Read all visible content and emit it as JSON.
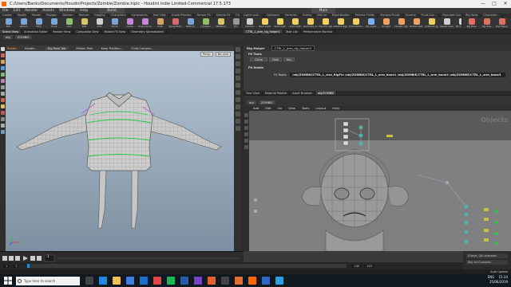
{
  "window": {
    "title": "C:/Users/Banks/Documents/HoudiniProjects/Zombie/Zombie.hiplc - Houdini Indie Limited-Commercial 17.5.173",
    "controls": [
      "—",
      "□",
      "✕"
    ]
  },
  "menubar": [
    "File",
    "Edit",
    "Render",
    "Assets",
    "Windows",
    "Help"
  ],
  "build_label": "Build",
  "main_label": "Main",
  "shelf_left": {
    "tabs": [
      "Create",
      "Modify",
      "Model",
      "Polygon",
      "Deform",
      "Texture",
      "Rigging",
      "Characters",
      "Constraints",
      "Hair Utils",
      "Guide Process",
      "Terrain FX",
      "Simple FX",
      "Cloud FX"
    ],
    "tools": [
      {
        "label": "Box",
        "color": "#7aa6d6"
      },
      {
        "label": "Sphere",
        "color": "#7aa6d6"
      },
      {
        "label": "Tube",
        "color": "#7aa6d6"
      },
      {
        "label": "Torus",
        "color": "#7aa6d6"
      },
      {
        "label": "Grid",
        "color": "#8fbf6a"
      },
      {
        "label": "Null",
        "color": "#d6c36a"
      },
      {
        "label": "Line",
        "color": "#d0d0d0"
      },
      {
        "label": "Circle",
        "color": "#7aa6d6"
      },
      {
        "label": "Curve",
        "color": "#c58ad6"
      },
      {
        "label": "Draw Curve",
        "color": "#c58ad6"
      },
      {
        "label": "Path",
        "color": "#d6a56a"
      },
      {
        "label": "Spray Paint",
        "color": "#d66a6a"
      },
      {
        "label": "Platonic",
        "color": "#7aa6d6"
      },
      {
        "label": "L-System",
        "color": "#8fbf6a"
      },
      {
        "label": "Metaball",
        "color": "#d6c36a"
      },
      {
        "label": "File",
        "color": "#9a9a9a"
      }
    ]
  },
  "shelf_right": {
    "tabs": [
      "Lights and...",
      "Collisions",
      "Particles",
      "Grains",
      "Vellum",
      "Rigid Bodies",
      "Particle Fluids",
      "Viscous Fluids",
      "Oceans",
      "Fluid Con...",
      "Populate Con...",
      "Container Tools",
      "Pyro FX",
      "Sparse Pyro FX",
      "FEM",
      "Wires",
      "Crowds",
      "Drive Simulation"
    ],
    "tools": [
      {
        "label": "Camera",
        "color": "#d0d0d0"
      },
      {
        "label": "Point Light",
        "color": "#f0d060"
      },
      {
        "label": "Spot Light",
        "color": "#f0d060"
      },
      {
        "label": "Area Light",
        "color": "#f0d060"
      },
      {
        "label": "Geometry Light",
        "color": "#f0d060"
      },
      {
        "label": "Volume Light",
        "color": "#f0d060"
      },
      {
        "label": "Distant Light",
        "color": "#f0d060"
      },
      {
        "label": "Environment Light",
        "color": "#f0d060"
      },
      {
        "label": "Sky Light",
        "color": "#7ab0f0"
      },
      {
        "label": "GI Light",
        "color": "#f0a060"
      },
      {
        "label": "Caustic Light",
        "color": "#f0a060"
      },
      {
        "label": "Portal Light",
        "color": "#f0a060"
      },
      {
        "label": "Ambient Light",
        "color": "#f0d060"
      },
      {
        "label": "Stereo Camera",
        "color": "#d0d0d0"
      },
      {
        "label": "VR Camera",
        "color": "#d0d0d0"
      },
      {
        "label": "Switcher",
        "color": "#d0d0d0"
      },
      {
        "label": "Gamepad Camera",
        "color": "#d0d0d0"
      }
    ]
  },
  "shelf_right2": {
    "tabs": [
      "Rig Tools",
      "Character..."
    ],
    "tools": [
      {
        "label": "Rig Pose",
        "color": "#e07060"
      },
      {
        "label": "Rig Tree",
        "color": "#e07060"
      },
      {
        "label": "Rig Helper",
        "color": "#e07060"
      },
      {
        "label": "Rig Edit",
        "color": "#e07060"
      }
    ]
  },
  "viewer_tabs": [
    "Scene View",
    "Animation Editor",
    "Render View",
    "Composite View",
    "Motion FX View",
    "Geometry Spreadsheet"
  ],
  "viewer_path": [
    "obj",
    "ZOMBIE"
  ],
  "viewport_toolbar": {
    "tool": "Rotate",
    "handle": "Handle...",
    "group_label": "Rig Pose Tab",
    "motion_path": "Motion Path",
    "keep_position": "Keep Position...",
    "child_compensation": "Child Compen..."
  },
  "viewport_labels": {
    "view": "Persp",
    "cam": "No cam"
  },
  "rig_tabs": [
    "CTRL_L_arm_rig_helper1",
    "Take List",
    "Performance Monitor"
  ],
  "rig_header": {
    "title": "Rig Helper",
    "node_name": "CTRL_L_arm_rig_helper3"
  },
  "rig_params": {
    "fk_tools_label": "FK Tools",
    "buttons": [
      "Clone",
      "Hide",
      "Key"
    ],
    "fk_nodes_label": "FK Nodes",
    "fk_roots_label": "FK Roots",
    "fk_roots_value": "/obj/ZOMBIE/CTRL_L_clav_RigFin /obj/ZOMBIE/CTRL_L_arm_bone1 /obj/ZOMBIE/CTRL_L_arm_bone2 /obj/ZOMBIE/CTRL_L_arm_bone3"
  },
  "network_tabs": [
    "Tree View",
    "Material Palette",
    "Asset Browser",
    "obj/ZOMBIE"
  ],
  "network_path": [
    "obj",
    "ZOMBIE"
  ],
  "network_menu": [
    "Add",
    "Edit",
    "Go",
    "View",
    "Tools",
    "Layout",
    "Help"
  ],
  "network_label": "Objects",
  "playbar": {
    "frame": "1",
    "start": "1",
    "end": "240",
    "end2": "240"
  },
  "timeline_ticks": [
    "24",
    "48",
    "72",
    "96",
    "120",
    "144",
    "168",
    "192",
    "216",
    "240"
  ],
  "status": {
    "keys": "0 keys, 0/0 channels",
    "key_all": "Key All Channels",
    "auto": "Auto Update"
  },
  "taskbar": {
    "search_placeholder": "Type here to search",
    "time": "15:34",
    "date": "25/06/2019",
    "lang": "ENG"
  },
  "colors": {
    "accent": "#ff6600",
    "selection_green": "#27c847",
    "node_teal": "#4fb3a8"
  }
}
